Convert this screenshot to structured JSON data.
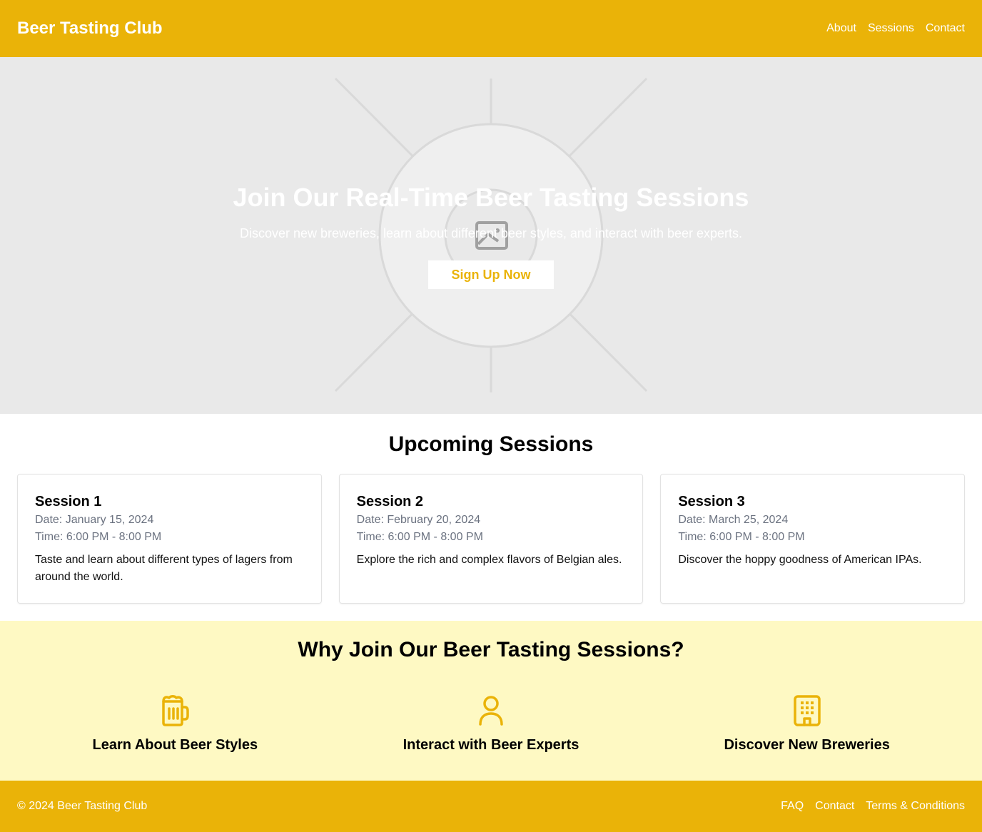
{
  "header": {
    "brand": "Beer Tasting Club",
    "nav": [
      "About",
      "Sessions",
      "Contact"
    ]
  },
  "hero": {
    "title": "Join Our Real-Time Beer Tasting Sessions",
    "subtitle": "Discover new breweries, learn about different beer styles, and interact with beer experts.",
    "button": "Sign Up Now",
    "background_icon": "image-placeholder-icon"
  },
  "sessions": {
    "title": "Upcoming Sessions",
    "items": [
      {
        "title": "Session 1",
        "date": "Date: January 15, 2024",
        "time": "Time: 6:00 PM - 8:00 PM",
        "description": "Taste and learn about different types of lagers from around the world."
      },
      {
        "title": "Session 2",
        "date": "Date: February 20, 2024",
        "time": "Time: 6:00 PM - 8:00 PM",
        "description": "Explore the rich and complex flavors of Belgian ales."
      },
      {
        "title": "Session 3",
        "date": "Date: March 25, 2024",
        "time": "Time: 6:00 PM - 8:00 PM",
        "description": "Discover the hoppy goodness of American IPAs."
      }
    ]
  },
  "why": {
    "title": "Why Join Our Beer Tasting Sessions?",
    "features": [
      {
        "label": "Learn About Beer Styles",
        "icon": "beer-mug-icon"
      },
      {
        "label": "Interact with Beer Experts",
        "icon": "user-icon"
      },
      {
        "label": "Discover New Breweries",
        "icon": "building-icon"
      }
    ]
  },
  "footer": {
    "copyright": "© 2024 Beer Tasting Club",
    "links": [
      "FAQ",
      "Contact",
      "Terms & Conditions"
    ]
  },
  "colors": {
    "primary": "#eab308",
    "hero_bg": "#e9e9e9",
    "why_bg": "#fef9c3",
    "muted_text": "#6b7280"
  }
}
